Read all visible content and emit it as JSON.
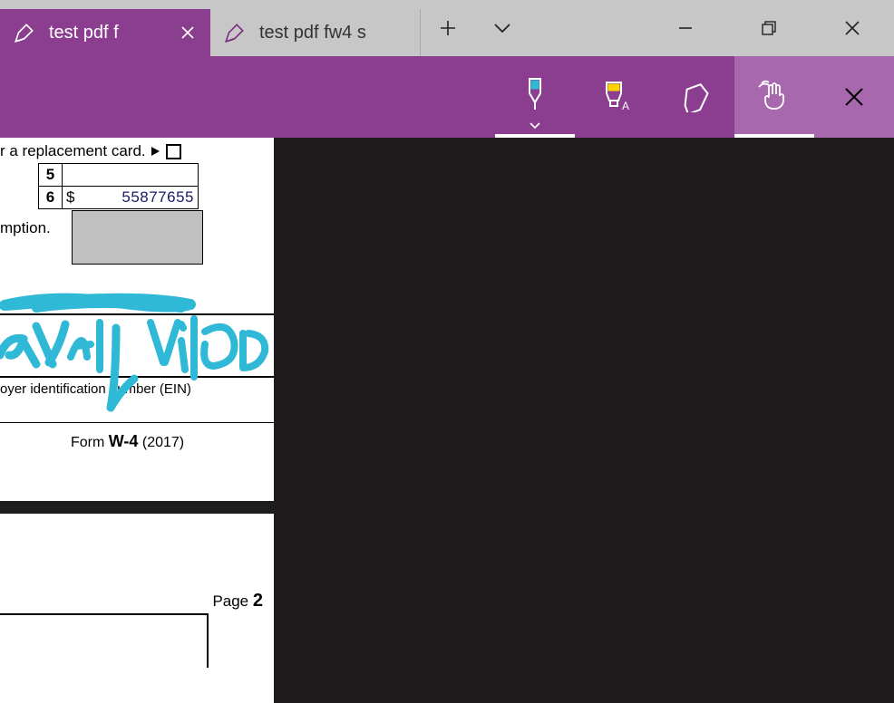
{
  "tabs": [
    {
      "title": "test pdf f",
      "active": true
    },
    {
      "title": "test pdf fw4 s",
      "active": false
    }
  ],
  "ink": {
    "pen": "Ballpoint pen",
    "highlighter": "Highlighter",
    "eraser": "Eraser",
    "touch": "Touch writing",
    "close": "Close ink toolbar"
  },
  "doc": {
    "replacement_text": "r a replacement card.",
    "row5": "5",
    "row6": "6",
    "dollar_sign": "$",
    "amount6": "55877655",
    "mption": "mption.",
    "ein_label": "oyer identification number (EIN)",
    "form_prefix": "Form ",
    "form_name": "W-4",
    "form_year": " (2017)",
    "page_label": "Page ",
    "page_num": "2"
  },
  "colors": {
    "brand": "#8b3e90",
    "ink_stroke": "#2fb9d6",
    "highlighter_tip": "#ffd400"
  }
}
